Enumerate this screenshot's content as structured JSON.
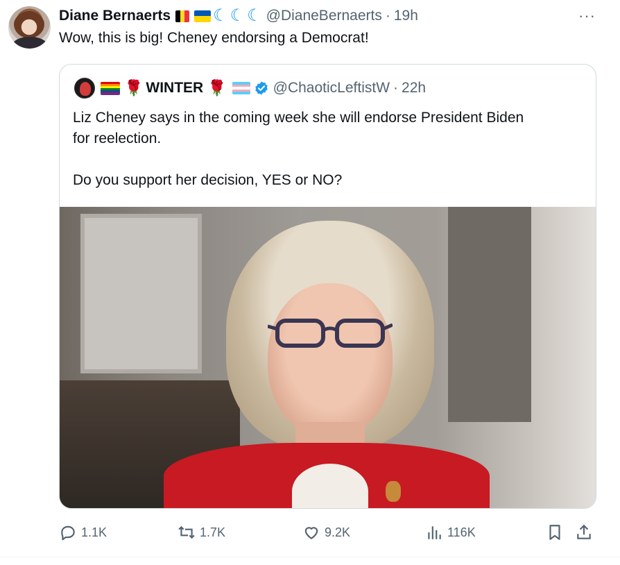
{
  "tweet": {
    "author_name": "Diane Bernaerts",
    "flags": [
      "belgium-flag",
      "ukraine-flag"
    ],
    "emojis": [
      "crescent-wave-icon",
      "crescent-wave-icon",
      "crescent-wave-icon"
    ],
    "handle": "@DianeBernaerts",
    "separator": "·",
    "time": "19h",
    "more_label": "···",
    "text": "Wow, this is big! Cheney endorsing a Democrat!"
  },
  "quote": {
    "author_name": "WINTER",
    "badges": [
      "rainbow-flag",
      "rose-icon",
      "rose-icon",
      "trans-flag",
      "verified-badge-icon"
    ],
    "handle": "@ChaoticLeftistW",
    "separator": "·",
    "time": "22h",
    "text_line1": "Liz Cheney says in the coming week she will endorse President Biden",
    "text_line2": "for reelection.",
    "text_line3": "Do you support her decision, YES or NO?",
    "image_alt": "photo-of-woman-in-red-jacket"
  },
  "actions": {
    "replies": "1.1K",
    "retweets": "1.7K",
    "likes": "9.2K",
    "views": "116K"
  },
  "colors": {
    "accent": "#1d9bf0",
    "muted": "#536471",
    "border": "#cfd9de",
    "text": "#0f1419"
  }
}
